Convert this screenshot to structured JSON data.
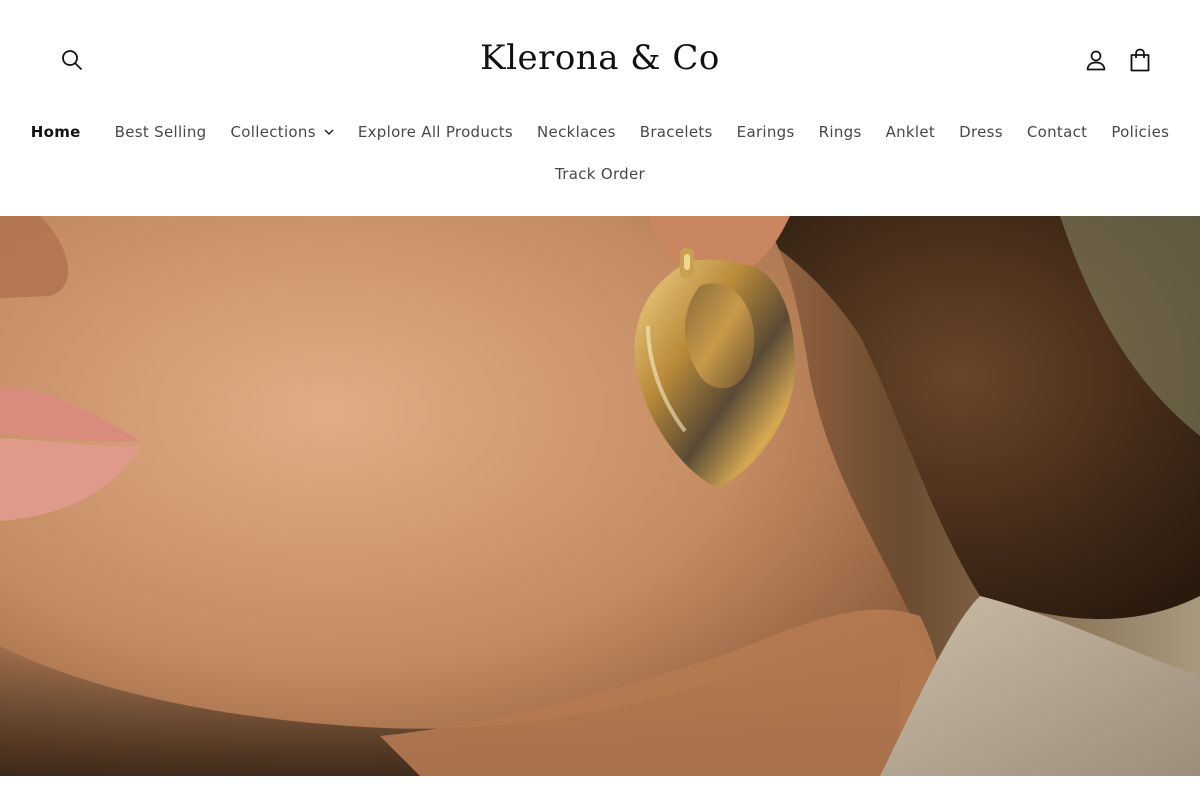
{
  "header": {
    "logo": "Klerona & Co",
    "icons": {
      "search": "search-icon",
      "account": "user-icon",
      "cart": "shopping-bag-icon"
    }
  },
  "nav": {
    "row1": [
      {
        "label": "Home",
        "active": true
      },
      {
        "label": "Best Selling"
      },
      {
        "label": "Collections",
        "has_dropdown": true
      },
      {
        "label": "Explore All Products"
      },
      {
        "label": "Necklaces"
      },
      {
        "label": "Bracelets"
      },
      {
        "label": "Earings"
      },
      {
        "label": "Rings"
      },
      {
        "label": "Anklet"
      },
      {
        "label": "Dress"
      },
      {
        "label": "Contact"
      },
      {
        "label": "Policies"
      }
    ],
    "row2": [
      {
        "label": "Track Order"
      }
    ]
  },
  "hero": {
    "image": "close-up-gold-hoop-earring-photo"
  },
  "colors": {
    "text": "#121212",
    "background": "#ffffff"
  }
}
